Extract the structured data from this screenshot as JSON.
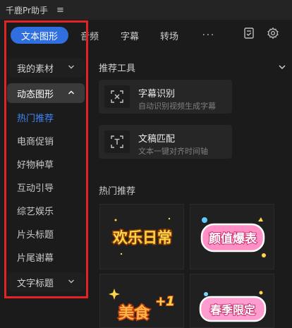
{
  "app": {
    "title": "千鹿Pr助手",
    "menu_glyph": "≡"
  },
  "tabs": [
    {
      "label": "文本图形",
      "active": true
    },
    {
      "label": "音频"
    },
    {
      "label": "字幕"
    },
    {
      "label": "转场"
    },
    {
      "label": "···"
    }
  ],
  "toolbar_icons": [
    "clipboard-check-icon",
    "gear-icon"
  ],
  "sidebar": {
    "my_assets": "我的素材",
    "dynamic_graphics": "动态图形",
    "items": [
      {
        "label": "热门推荐",
        "active": true
      },
      {
        "label": "电商促销"
      },
      {
        "label": "好物种草"
      },
      {
        "label": "互动引导"
      },
      {
        "label": "综艺娱乐"
      },
      {
        "label": "片头标题"
      },
      {
        "label": "片尾谢幕"
      }
    ],
    "text_titles": "文字标题"
  },
  "main": {
    "tools_title": "推荐工具",
    "tools": [
      {
        "name": "字幕识别",
        "desc": "自动识别视频生成字幕",
        "icon": "subtitle-recognition-icon"
      },
      {
        "name": "文稿匹配",
        "desc": "文本一键对齐时间轴",
        "icon": "text-match-icon"
      }
    ],
    "hot_title": "热门推荐",
    "thumbnails": [
      {
        "text": "欢乐日常"
      },
      {
        "text": "颜值爆表"
      },
      {
        "text": "美食",
        "extra": "+1"
      },
      {
        "text": "春季限定"
      }
    ]
  },
  "colors": {
    "accent": "#2f6fe0",
    "active_item": "#3d86f5",
    "highlight_box": "#e02424",
    "background": "#1b1b1b"
  }
}
